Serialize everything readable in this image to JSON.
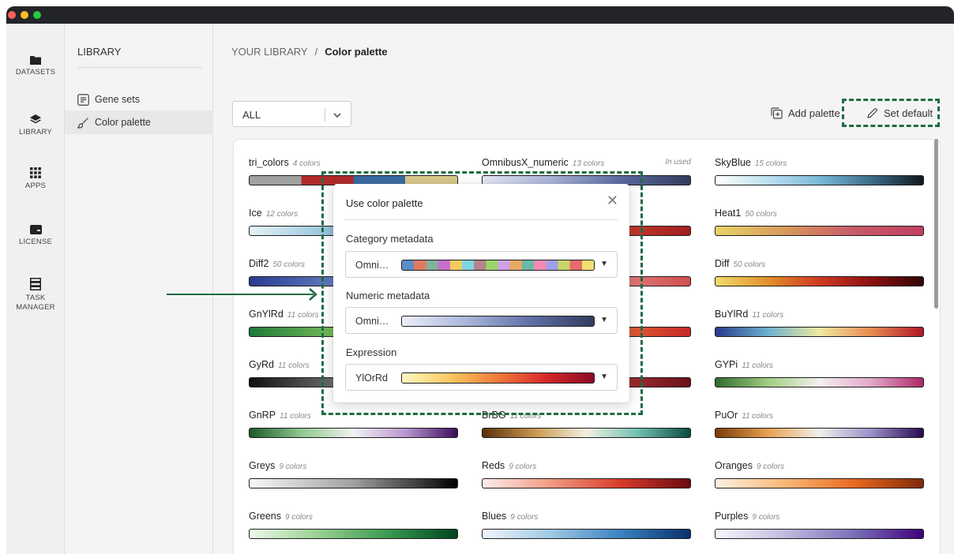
{
  "rail": {
    "items": [
      {
        "label": "DATASETS",
        "icon": "folder-icon"
      },
      {
        "label": "LIBRARY",
        "icon": "layers-icon"
      },
      {
        "label": "APPS",
        "icon": "grid-icon"
      },
      {
        "label": "LICENSE",
        "icon": "card-icon"
      },
      {
        "label": "TASK",
        "label2": "MANAGER",
        "icon": "server-icon"
      }
    ]
  },
  "sidebar": {
    "title": "LIBRARY",
    "items": [
      {
        "label": "Gene sets",
        "icon": "list-icon"
      },
      {
        "label": "Color palette",
        "icon": "brush-icon"
      }
    ]
  },
  "breadcrumb": {
    "root": "YOUR LIBRARY",
    "separator": "/",
    "current": "Color palette"
  },
  "filter": {
    "value": "ALL"
  },
  "toolbar": {
    "add_label": "Add palette",
    "default_label": "Set default"
  },
  "palettes": [
    {
      "name": "tri_colors",
      "count": "4 colors"
    },
    {
      "name": "OmnibusX_numeric",
      "count": "13 colors",
      "badge": "In used"
    },
    {
      "name": "SkyBlue",
      "count": "15 colors"
    },
    {
      "name": "Ice",
      "count": "12 colors"
    },
    {
      "name": "Heat1",
      "count": "50 colors"
    },
    {
      "name": "Diff2",
      "count": "50 colors"
    },
    {
      "name": "Diff",
      "count": "50 colors"
    },
    {
      "name": "GnYlRd",
      "count": "11 colors"
    },
    {
      "name": "BuYlRd",
      "count": "11 colors"
    },
    {
      "name": "GyRd",
      "count": "11 colors"
    },
    {
      "name": "GYPi",
      "count": "11 colors"
    },
    {
      "name": "GnRP",
      "count": "11 colors"
    },
    {
      "name": "BrBG",
      "count": "11 colors"
    },
    {
      "name": "PuOr",
      "count": "11 colors"
    },
    {
      "name": "Greys",
      "count": "9 colors"
    },
    {
      "name": "Reds",
      "count": "9 colors"
    },
    {
      "name": "Oranges",
      "count": "9 colors"
    },
    {
      "name": "Greens",
      "count": "9 colors"
    },
    {
      "name": "Blues",
      "count": "9 colors"
    },
    {
      "name": "Purples",
      "count": "9 colors"
    }
  ],
  "modal": {
    "title": "Use color palette",
    "category": {
      "label": "Category metadata",
      "value": "Omni…"
    },
    "numeric": {
      "label": "Numeric metadata",
      "value": "Omni…"
    },
    "expression": {
      "label": "Expression",
      "value": "YlOrRd"
    }
  },
  "colors": {
    "annotation": "#1f6b43",
    "close_dot": "#ff5f57",
    "min_dot": "#febc2e",
    "max_dot": "#28c840"
  }
}
